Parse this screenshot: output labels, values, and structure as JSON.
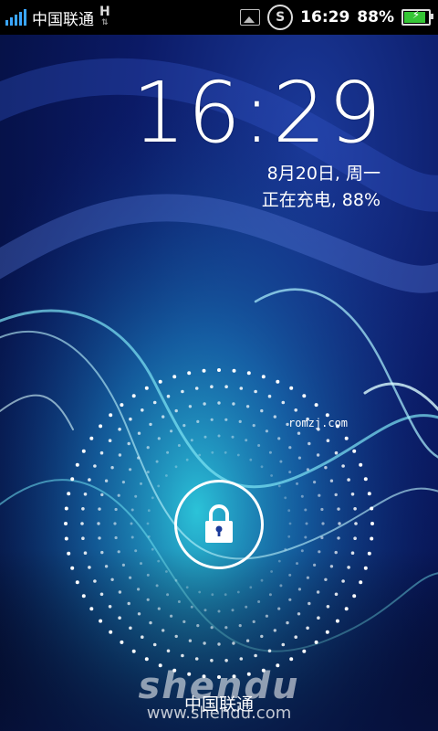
{
  "statusbar": {
    "carrier": "中国联通",
    "network_type": "H",
    "time": "16:29",
    "battery_percent": "88%",
    "battery_level": 0.88,
    "signal_level": 5
  },
  "lockscreen": {
    "clock": "16:29",
    "date": "8月20日, 周一",
    "charging": "正在充电, 88%",
    "carrier": "中国联通",
    "watermark": "romzj.com",
    "brand_logo": "shendu",
    "brand_url": "www.shendu.com"
  },
  "icons": {
    "lock": "lock-icon",
    "gallery": "gallery-notification-icon",
    "shield": "security-icon",
    "battery": "battery-charging-icon"
  },
  "colors": {
    "signal": "#3aa6ff",
    "battery": "#36c636",
    "ring": "#ffffff"
  }
}
